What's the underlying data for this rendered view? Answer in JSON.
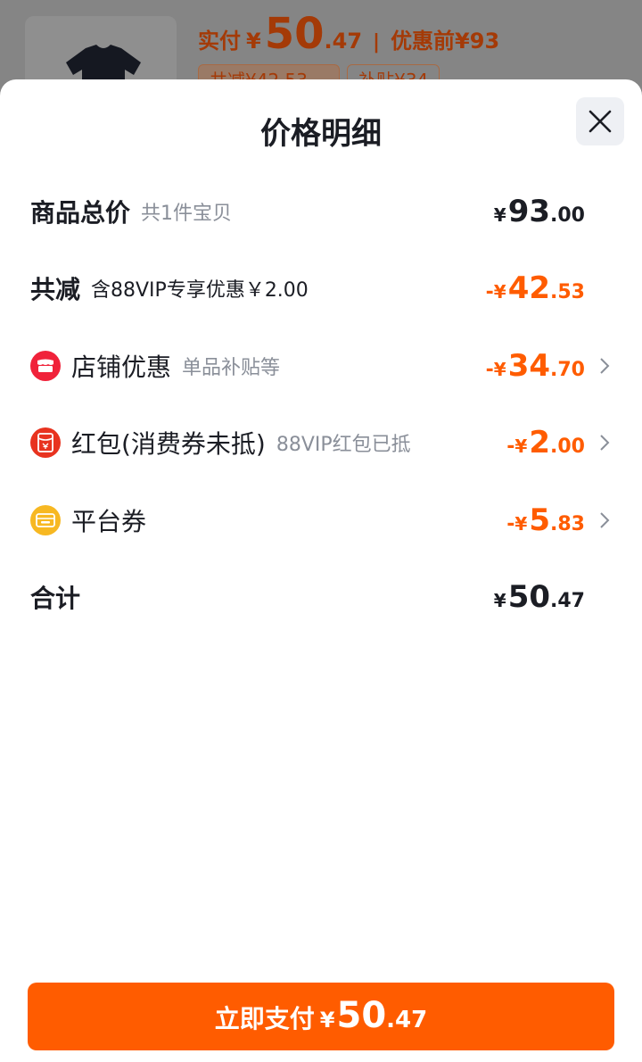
{
  "background": {
    "price_label": "实付",
    "price_symbol": "¥",
    "price_int": "50",
    "price_dec": ".47",
    "separator": "|",
    "original_price": "优惠前¥93",
    "tags": [
      "共减¥42.53 ⌄",
      "补贴¥34"
    ]
  },
  "sheet": {
    "title": "价格明细",
    "rows": [
      {
        "label": "商品总价",
        "sub": "共1件宝贝",
        "sign": "",
        "symbol": "¥",
        "int": "93",
        "dec": ".00",
        "color": "black"
      },
      {
        "label": "共减",
        "sub": "含88VIP专享优惠￥2.00",
        "sign": "-",
        "symbol": "¥",
        "int": "42",
        "dec": ".53",
        "color": "orange"
      },
      {
        "label": "店铺优惠",
        "sub": "单品补贴等",
        "sign": "-",
        "symbol": "¥",
        "int": "34",
        "dec": ".70",
        "color": "orange",
        "icon": "store-icon",
        "icon_color": "#f0223a"
      },
      {
        "label": "红包(消费券未抵)",
        "sub": "88VIP红包已抵",
        "sign": "-",
        "symbol": "¥",
        "int": "2",
        "dec": ".00",
        "color": "orange",
        "icon": "red-packet-icon",
        "icon_color": "#e8331f"
      },
      {
        "label": "平台券",
        "sub": "",
        "sign": "-",
        "symbol": "¥",
        "int": "5",
        "dec": ".83",
        "color": "orange",
        "icon": "coupon-icon",
        "icon_color": "#f7b822"
      },
      {
        "label": "合计",
        "sub": "",
        "sign": "",
        "symbol": "¥",
        "int": "50",
        "dec": ".47",
        "color": "black"
      }
    ]
  },
  "pay_button": {
    "label": "立即支付",
    "symbol": "¥",
    "int": "50",
    "dec": ".47"
  },
  "colors": {
    "accent": "#ff5c00",
    "text": "#1b1d24",
    "muted": "#8a8f99"
  }
}
